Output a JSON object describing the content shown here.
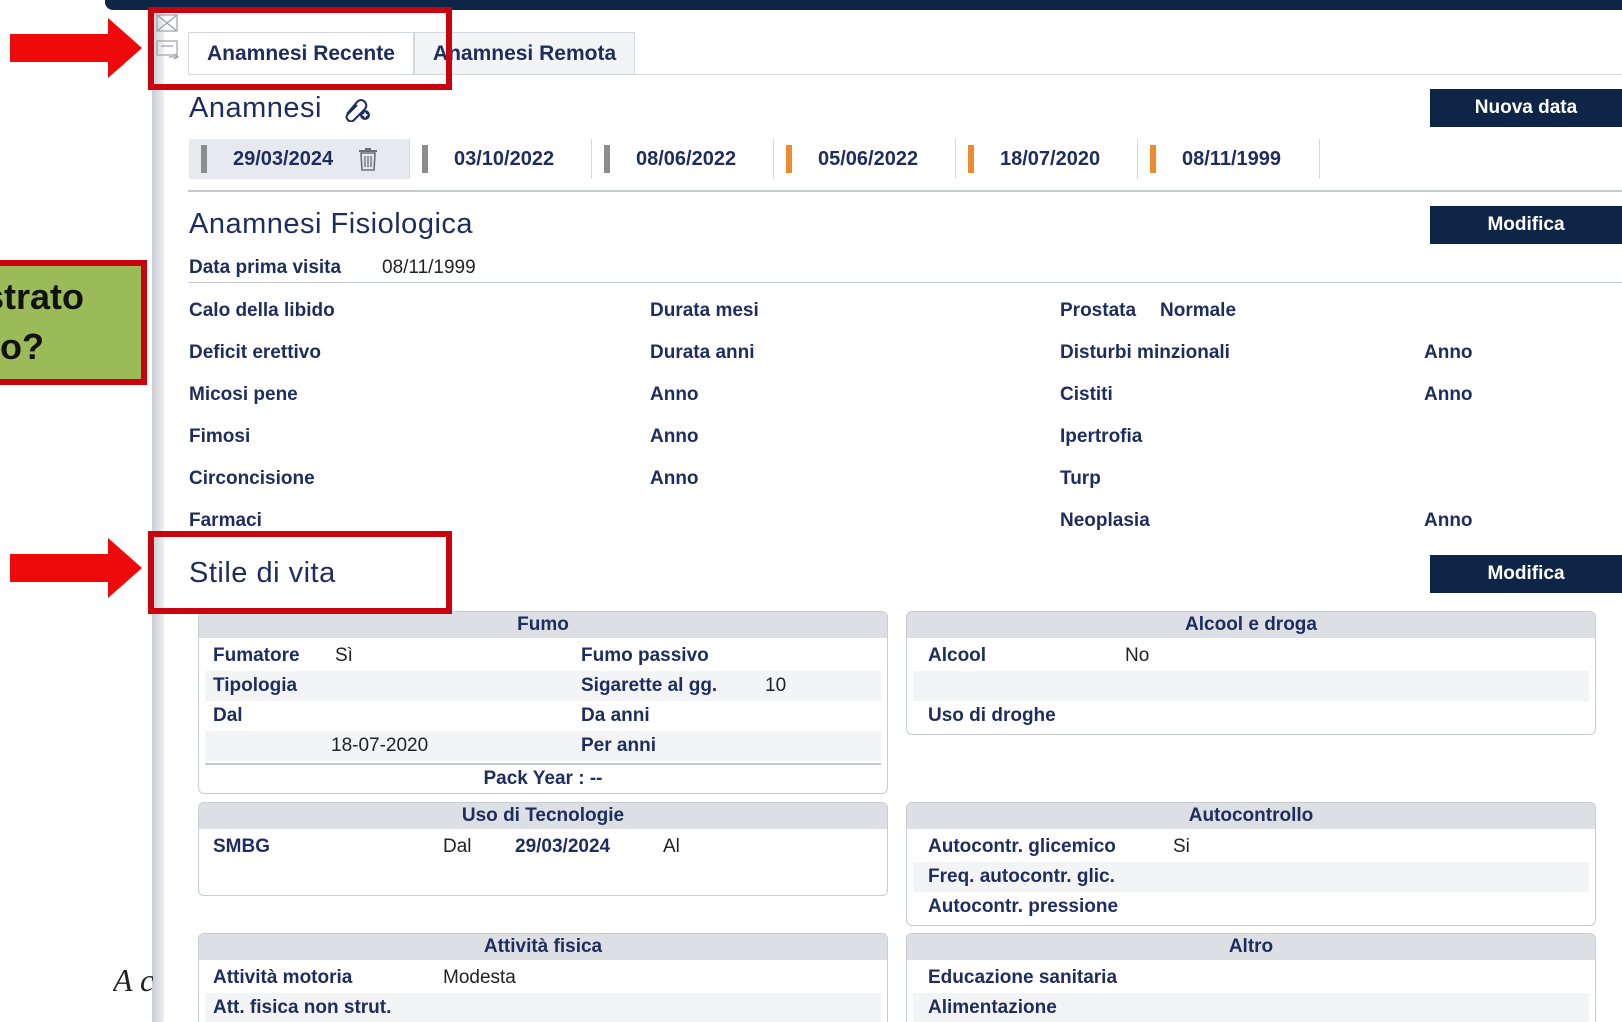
{
  "tabs": {
    "recent": "Anamnesi Recente",
    "remote": "Anamnesi Remota"
  },
  "anamnesi": {
    "title": "Anamnesi",
    "new_date_button": "Nuova data",
    "dates": [
      {
        "date": "29/03/2024",
        "marker_color": "#8c8c8c"
      },
      {
        "date": "03/10/2022",
        "marker_color": "#8c8c8c"
      },
      {
        "date": "08/06/2022",
        "marker_color": "#8c8c8c"
      },
      {
        "date": "05/06/2022",
        "marker_color": "#f08a30"
      },
      {
        "date": "18/07/2020",
        "marker_color": "#f08a30"
      },
      {
        "date": "08/11/1999",
        "marker_color": "#f08a30"
      }
    ]
  },
  "fisiologica": {
    "title": "Anamnesi Fisiologica",
    "edit_button": "Modifica",
    "first_visit_label": "Data prima visita",
    "first_visit_value": "08/11/1999",
    "col1": [
      "Calo della libido",
      "Deficit erettivo",
      "Micosi pene",
      "Fimosi",
      "Circoncisione",
      "Farmaci"
    ],
    "col2": [
      "Durata mesi",
      "Durata anni",
      "Anno",
      "Anno",
      "Anno"
    ],
    "col3": [
      "Prostata",
      "Disturbi minzionali",
      "Cistiti",
      "Ipertrofia",
      "Turp",
      "Neoplasia"
    ],
    "prostata_value": "Normale",
    "col4": [
      "Anno",
      "Anno",
      "Anno"
    ]
  },
  "stile": {
    "title": "Stile di vita",
    "edit_button": "Modifica",
    "fumo": {
      "header": "Fumo",
      "fumatore_label": "Fumatore",
      "fumatore_value": "Sì",
      "fumo_passivo_label": "Fumo passivo",
      "tipologia_label": "Tipologia",
      "sigarette_label": "Sigarette al gg.",
      "sigarette_value": "10",
      "dal_label": "Dal",
      "da_anni_label": "Da anni",
      "dal_value": "18-07-2020",
      "per_anni_label": "Per anni",
      "pack_year": "Pack Year : --"
    },
    "alcool": {
      "header": "Alcool e droga",
      "alcool_label": "Alcool",
      "alcool_value": "No",
      "droghe_label": "Uso di droghe"
    },
    "tecnologie": {
      "header": "Uso di Tecnologie",
      "smbg_label": "SMBG",
      "dal_label": "Dal",
      "dal_value": "29/03/2024",
      "al_label": "Al"
    },
    "autocontrollo": {
      "header": "Autocontrollo",
      "glicemico_label": "Autocontr. glicemico",
      "glicemico_value": "Si",
      "freq_label": "Freq. autocontr. glic.",
      "pressione_label": "Autocontr. pressione"
    },
    "attivita": {
      "header": "Attività fisica",
      "motoria_label": "Attività motoria",
      "motoria_value": "Modesta",
      "non_strut_label": "Att. fisica non strut."
    },
    "altro": {
      "header": "Altro",
      "educazione_label": "Educazione sanitaria",
      "alimentazione_label": "Alimentazione"
    }
  },
  "callout": {
    "line1": "gistrato",
    "line2": "o?"
  },
  "footnote": "A c",
  "colors": {
    "navy": "#0e2548",
    "label": "#1e2c5e",
    "highlight_red": "#c9040f",
    "callout_green": "#9bbb59"
  }
}
